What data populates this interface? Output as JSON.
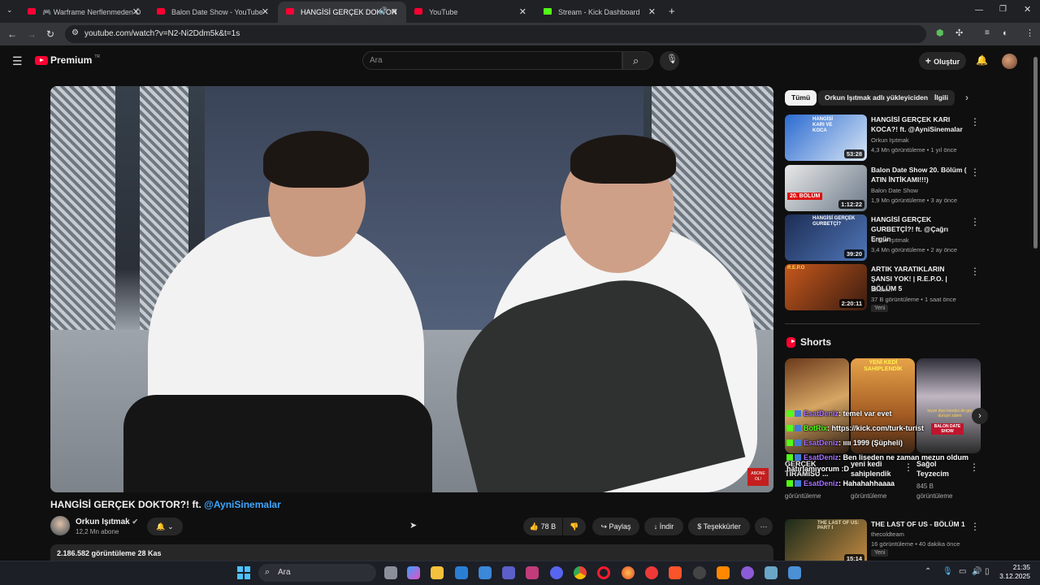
{
  "browser": {
    "tabs": [
      {
        "label": "🎮 Warframe Nerflenmeden Ö"
      },
      {
        "label": "Balon Date Show - YouTube"
      },
      {
        "label": "HANGİSİ GERÇEK DOKTOR"
      },
      {
        "label": "YouTube"
      },
      {
        "label": "Stream - Kick Dashboard"
      }
    ],
    "url": "youtube.com/watch?v=N2-Ni2Ddm5k&t=1s"
  },
  "header": {
    "logo_text": "Premium",
    "logo_sup": "TR",
    "search_placeholder": "Ara",
    "create_label": "Oluştur"
  },
  "video": {
    "title_main": "HANGİSİ GERÇEK DOKTOR?! ft. ",
    "title_link": "@AyniSinemalar",
    "channel_name": "Orkun Işıtmak",
    "subscribers": "12,2 Mn abone",
    "likes": "78 B",
    "share_label": "Paylaş",
    "download_label": "İndir",
    "thanks_label": "Teşekkürler",
    "views_date": "2.186.582 görüntüleme  28 Kas",
    "watermark": "ABONE OL!"
  },
  "sidebar": {
    "chips": [
      {
        "label": "Tümü"
      },
      {
        "label": "Orkun Işıtmak adlı yükleyiciden"
      },
      {
        "label": "İlgili"
      }
    ],
    "recs": [
      {
        "title": "HANGİSİ GERÇEK KARI KOCA?! ft. @AyniSinemalar",
        "channel": "Orkun Işıtmak",
        "meta": "4,3 Mn görüntüleme • 1 yıl önce",
        "duration": "53:28",
        "thumb_text": "HANGİSİ KARI VE KOCA"
      },
      {
        "title": "Balon Date Show 20. Bölüm ( ATIN İNTİKAMI!!!)",
        "channel": "Balon Date Show",
        "meta": "1,9 Mn görüntüleme • 3 ay önce",
        "duration": "1:12:22",
        "thumb_text": "20. BÖLÜM"
      },
      {
        "title": "HANGİSİ GERÇEK GURBETÇİ?! ft. @Çağrı Ergün",
        "channel": "Orkun Işıtmak",
        "meta": "3,4 Mn görüntüleme • 2 ay önce",
        "duration": "39:20",
        "thumb_text": "HANGİSİ GERÇEK GURBETÇİ?"
      },
      {
        "title": "ARTIK YARATIKLARIN ŞANSI YOK! | R.E.P.O. | BÖLÜM 5",
        "channel": "Elraenn",
        "meta": "37 B görüntüleme • 1 saat önce",
        "duration": "2:20:11",
        "badge": "Yeni",
        "thumb_text": "R.E.P.O"
      },
      {
        "title": "THE LAST OF US - BÖLÜM 1",
        "channel": "thecoldteam",
        "meta": "16 görüntüleme • 40 dakika önce",
        "duration": "15:14",
        "badge": "Yeni",
        "thumb_text": "THE LAST OF US: PART I"
      }
    ],
    "shorts_title": "Shorts",
    "shorts": [
      {
        "title": "GERÇEK TİRAMİSU ...",
        "views": "görüntüleme",
        "thumb_text": ""
      },
      {
        "title": "yeni kedi sahiplendik",
        "views": "görüntüleme",
        "thumb_text": "YENİ KEDİ SAHİPLENDİK"
      },
      {
        "title": "Sağol Teyzecim",
        "views_count": "845 B",
        "views": "görüntüleme",
        "thumb_text": "teyze diye kendisi de gizi duruyo zaten",
        "thumb_text2": "BALON DATE SHOW"
      }
    ]
  },
  "kick_chat": [
    {
      "user": "EsatDeniz",
      "msg": ": temel var evet",
      "style": "purple"
    },
    {
      "user": "BotRix",
      "msg": ": https://kick.com/turk-turist",
      "style": "green"
    },
    {
      "user": "EsatDeniz",
      "msg": ": ıııı 1999 (Şüpheli)",
      "style": "purple"
    },
    {
      "user": "EsatDeniz",
      "msg": ": Ben liseden ne zaman mezun oldum",
      "style": "purple"
    },
    {
      "user": "",
      "msg": "hatırlamıyorum :D",
      "style": "plain"
    },
    {
      "user": "EsatDeniz",
      "msg": ": Hahahahhaaaa",
      "style": "purple"
    }
  ],
  "taskbar": {
    "search_label": "Ara",
    "time": "21:35",
    "date": "3.12.2025"
  },
  "colors": {
    "accent": "#ff0033",
    "link": "#3ea6ff",
    "kick": "#53fc18"
  }
}
